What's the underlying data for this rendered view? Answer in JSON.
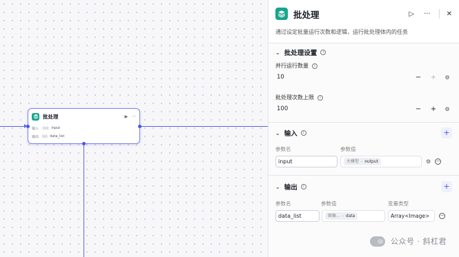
{
  "node": {
    "title": "批处理",
    "rows": [
      {
        "label": "输入",
        "tag": "{x}",
        "value": "input"
      },
      {
        "label": "输出",
        "tag": "[x]",
        "value": "data_list"
      }
    ]
  },
  "panel": {
    "title": "批处理",
    "description": "通过设定批量运行次数和逻辑，运行批处理体内的任务",
    "settings": {
      "title": "批处理设置",
      "concurrency": {
        "label": "并行运行数量",
        "value": "10"
      },
      "batch_limit": {
        "label": "批处理次数上限",
        "value": "100"
      }
    },
    "input": {
      "title": "输入",
      "col_name": "参数名",
      "col_value": "参数值",
      "rows": [
        {
          "name": "input",
          "source": "大模型",
          "sep": "-",
          "ref": "output"
        }
      ]
    },
    "output": {
      "title": "输出",
      "col_name": "参数名",
      "col_value": "参数值",
      "col_type": "变量类型",
      "rows": [
        {
          "name": "data_list",
          "source": "图像...",
          "sep": "-",
          "ref": "data",
          "type": "Array<Image>"
        }
      ]
    }
  },
  "watermark": "公众号 · 斜杠君",
  "colors": {
    "accent": "#4d53e8",
    "node_logo": "#17a58a",
    "wire": "#5b63e6"
  }
}
